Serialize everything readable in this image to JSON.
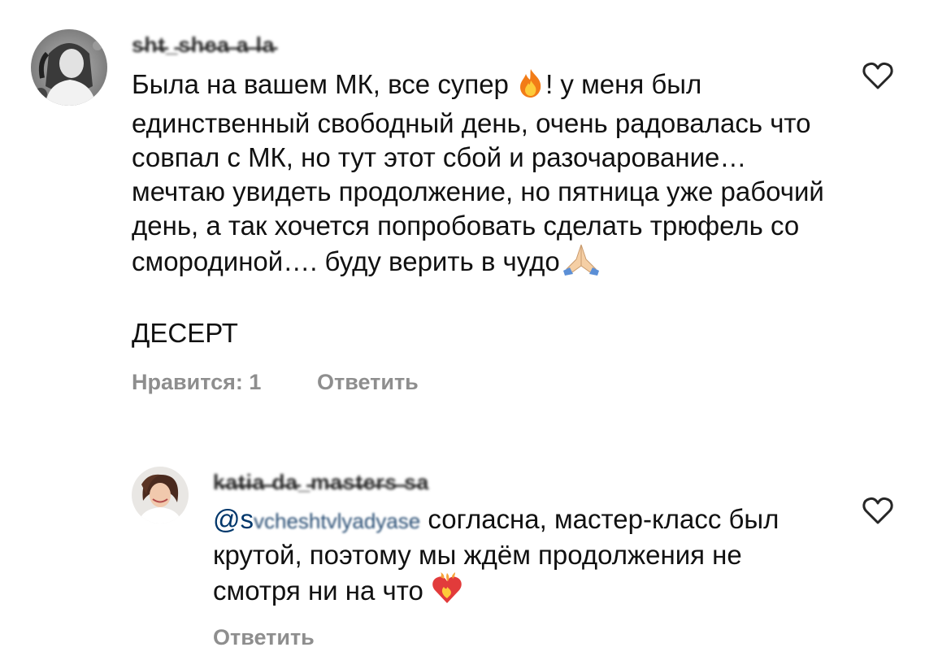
{
  "comments": [
    {
      "username": "s̵h̵t̵_̵s̵h̵e̵a̵ ̵a̵ ̵l̵a̵",
      "text_part1": "Была на вашем МК, все супер ",
      "text_part2": "! у меня был единственный свободный день, очень радовалась что совпал с МК, но тут этот сбой и разочарование… мечтаю увидеть продолжение, но пятница уже рабочий день, а так хочется попробовать сделать трюфель со смородиной…. буду верить в чудо",
      "tag_line": "ДЕСЕРТ",
      "likes_label": "Нравится: 1",
      "reply_label": "Ответить",
      "emoji_1": "fire-icon",
      "emoji_2": "folded-hands-icon"
    }
  ],
  "reply": {
    "username": "k̵a̵t̵i̵a̵ ̵d̵a̵_̵m̵a̵s̵t̵e̵r̵s̵ ̵s̵a",
    "mention_prefix": "@s",
    "mention_blurred": "vcheshtvlyadyase",
    "text": "согласна, мастер-класс был крутой, поэтому мы ждём продолжения не смотря ни на что",
    "reply_label": "Ответить",
    "emoji": "heart-on-fire-icon"
  },
  "colors": {
    "text": "#111111",
    "meta": "#8e8e8e",
    "mention": "#00376b"
  }
}
